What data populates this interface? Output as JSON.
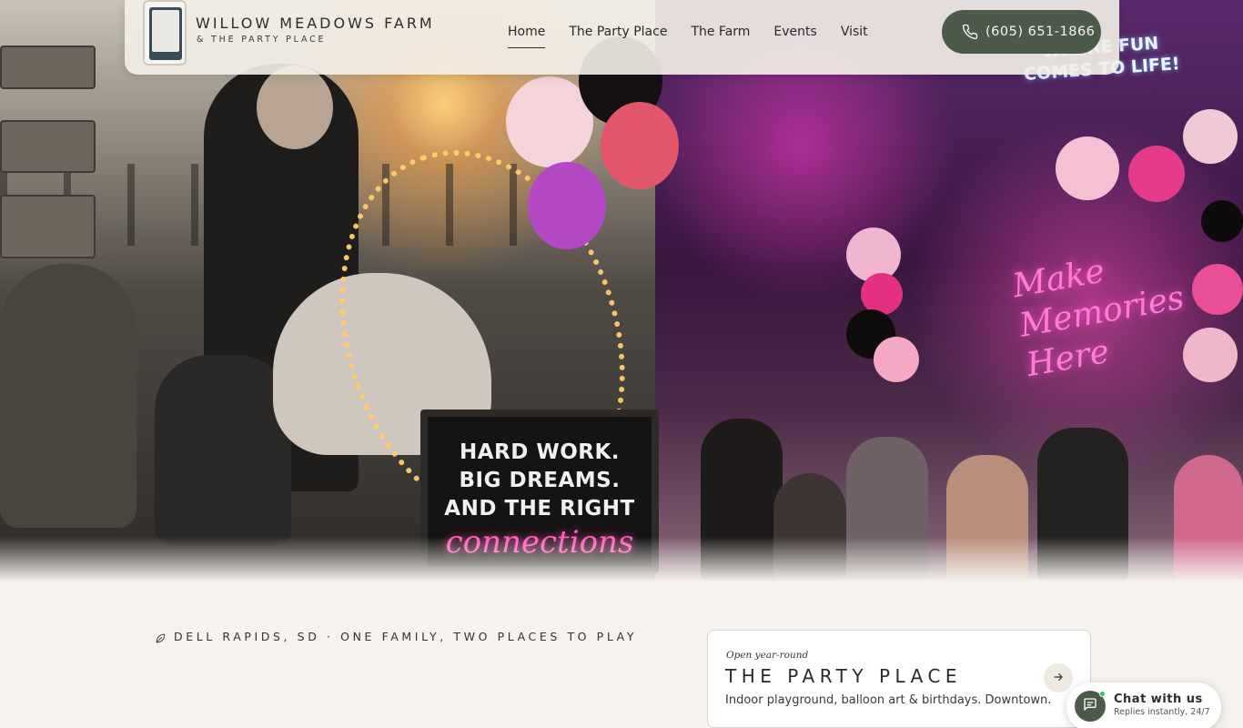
{
  "brand": {
    "name": "WILLOW MEADOWS FARM",
    "subtitle": "& THE PARTY PLACE",
    "logo_text": "WILLOW MEADOWS FARM"
  },
  "nav": {
    "items": [
      {
        "label": "Home",
        "active": true
      },
      {
        "label": "The Party Place",
        "active": false
      },
      {
        "label": "The Farm",
        "active": false
      },
      {
        "label": "Events",
        "active": false
      },
      {
        "label": "Visit",
        "active": false
      }
    ]
  },
  "phone": {
    "label": "(605) 651-1866",
    "icon": "phone-icon"
  },
  "hero": {
    "chalkboard_lines": [
      "HARD WORK.",
      "BIG DREAMS.",
      "AND THE RIGHT"
    ],
    "chalkboard_script": "connections",
    "neon_sign": "Make Memories Here",
    "neon_top": "WHERE FUN COMES TO LIFE!"
  },
  "location": {
    "icon": "leaf-icon",
    "text": "DELL RAPIDS, SD · ONE FAMILY, TWO PLACES TO PLAY"
  },
  "card": {
    "eyebrow": "Open year-round",
    "title": "THE PARTY PLACE",
    "description": "Indoor playground, balloon art & birthdays. Downtown.",
    "icon": "arrow-right-icon"
  },
  "chat": {
    "title": "Chat with us",
    "subtitle": "Replies instantly, 24/7",
    "icon": "chat-bubble-icon"
  },
  "colors": {
    "accent": "#4c5b49",
    "background": "#f6f3ee",
    "online": "#37c85a"
  }
}
